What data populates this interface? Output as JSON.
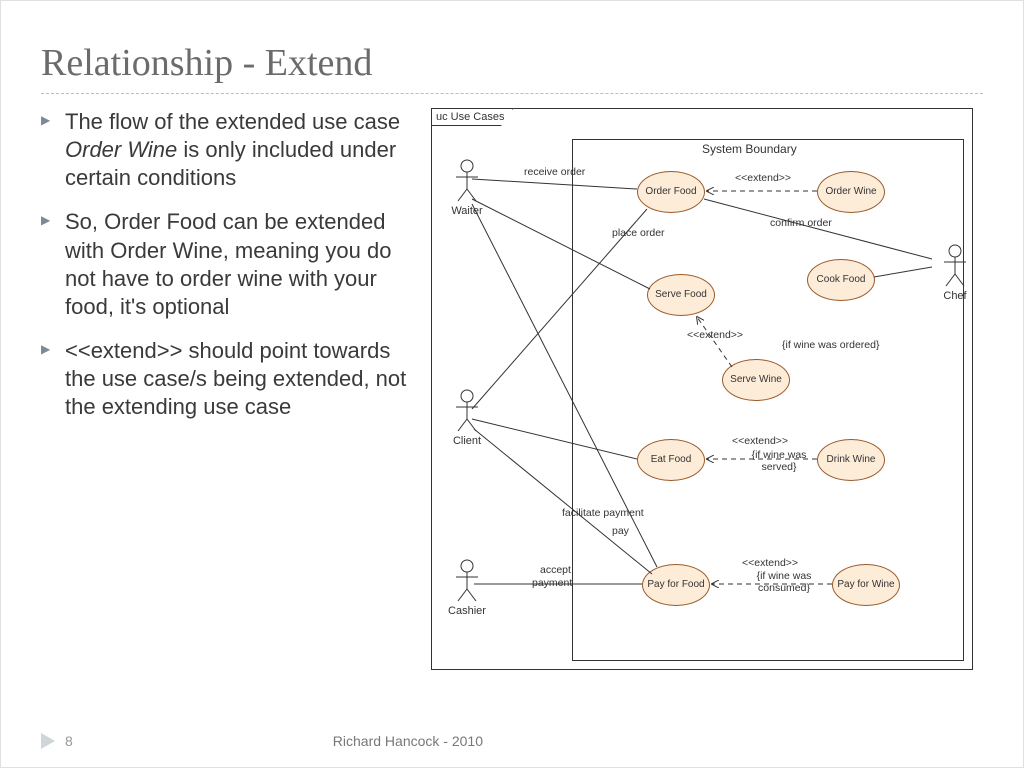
{
  "slide": {
    "title": "Relationship - Extend",
    "page_number": "8",
    "attribution": "Richard Hancock - 2010"
  },
  "bullets": [
    {
      "pre": "The flow of the extended use case ",
      "em": "Order Wine",
      "post": " is only included under certain conditions"
    },
    {
      "pre": "So, Order Food can be extended with Order Wine, meaning you do not have to order wine with your food, it's optional",
      "em": "",
      "post": ""
    },
    {
      "pre": "<<extend>> should point towards the use case/s being extended, not the extending use case",
      "em": "",
      "post": ""
    }
  ],
  "diagram": {
    "frame_label": "uc Use Cases",
    "system_label": "System Boundary",
    "actors": {
      "waiter": "Waiter",
      "client": "Client",
      "cashier": "Cashier",
      "chef": "Chef"
    },
    "usecases": {
      "order_food": "Order Food",
      "order_wine": "Order Wine",
      "serve_food": "Serve Food",
      "cook_food": "Cook Food",
      "serve_wine": "Serve Wine",
      "eat_food": "Eat Food",
      "drink_wine": "Drink Wine",
      "pay_food": "Pay for Food",
      "pay_wine": "Pay for Wine"
    },
    "edge_labels": {
      "receive_order": "receive order",
      "place_order": "place order",
      "confirm_order": "confirm order",
      "facilitate_payment": "facilitate payment",
      "pay": "pay",
      "accept_payment": "accept payment",
      "extend": "<<extend>>",
      "guard_wine_ordered": "{if wine was ordered}",
      "guard_wine_served": "{if wine was served}",
      "guard_wine_consumed": "{if wine was consumed}"
    }
  }
}
